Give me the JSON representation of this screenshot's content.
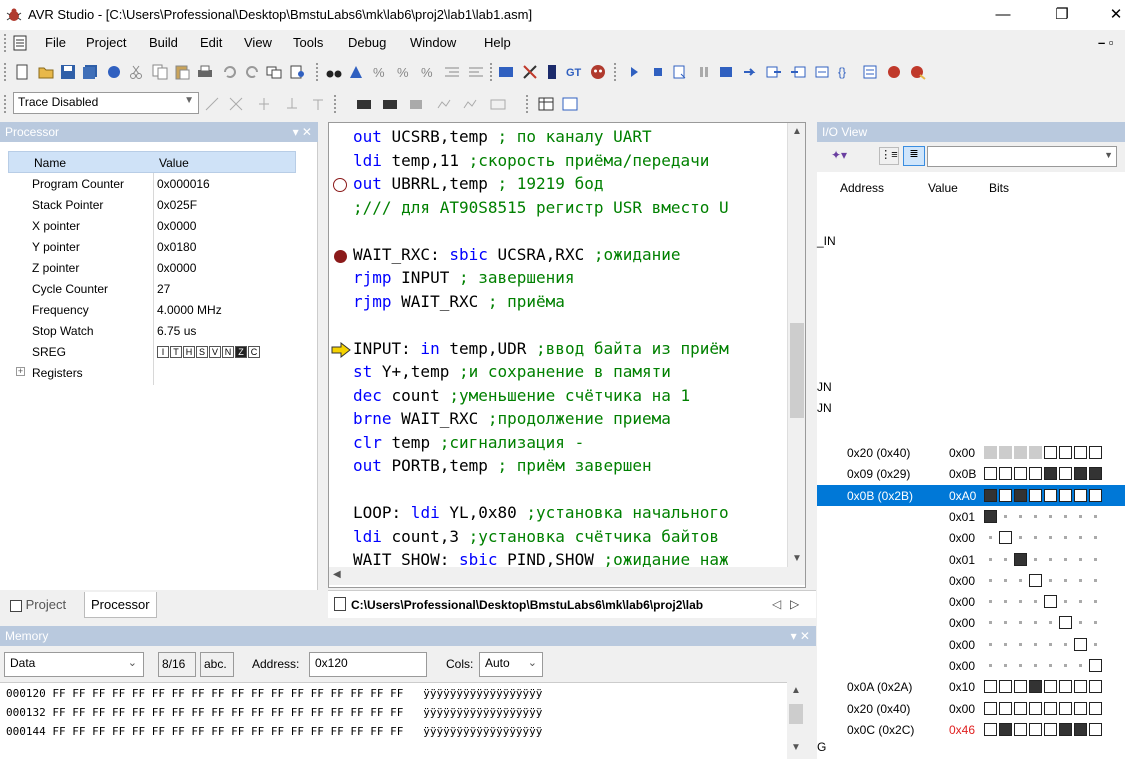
{
  "window": {
    "title": "AVR Studio - [C:\\Users\\Professional\\Desktop\\BmstuLabs6\\mk\\lab6\\proj2\\lab1\\lab1.asm]",
    "minimize": "—",
    "restore": "❐",
    "close": "✕"
  },
  "menu": [
    "File",
    "Project",
    "Build",
    "Edit",
    "View",
    "Tools",
    "Debug",
    "Window",
    "Help"
  ],
  "mdi_controls": "– ▫",
  "trace": {
    "value": "Trace Disabled"
  },
  "processor": {
    "title": "Processor",
    "headers": {
      "name": "Name",
      "value": "Value"
    },
    "rows": [
      {
        "name": "Program Counter",
        "value": "0x000016"
      },
      {
        "name": "Stack Pointer",
        "value": "0x025F"
      },
      {
        "name": "X pointer",
        "value": "0x0000"
      },
      {
        "name": "Y pointer",
        "value": "0x0180"
      },
      {
        "name": "Z pointer",
        "value": "0x0000"
      },
      {
        "name": "Cycle Counter",
        "value": "27"
      },
      {
        "name": "Frequency",
        "value": "4.0000 MHz"
      },
      {
        "name": "Stop Watch",
        "value": "6.75 us"
      }
    ],
    "sreg": {
      "name": "SREG",
      "flags": [
        "I",
        "T",
        "H",
        "S",
        "V",
        "N",
        "Z",
        "C"
      ],
      "set_flags": [
        "Z"
      ]
    },
    "registers": "Registers"
  },
  "tabs": {
    "project": "Project",
    "processor": "Processor"
  },
  "editor": {
    "lines": [
      {
        "marker": "",
        "kw": "out",
        "rest": " UCSRB,temp",
        "comment": " ; по каналу UART"
      },
      {
        "marker": "",
        "kw": "ldi",
        "rest": " temp,11",
        "comment": " ;скорость приёма/передачи"
      },
      {
        "marker": "bp-empty",
        "kw": "out",
        "rest": " UBRRL,temp",
        "comment": " ; 19219 бод"
      },
      {
        "marker": "",
        "kw": "",
        "rest": "",
        "comment": ";/// для AT90S8515 регистр USR вместо U"
      },
      {
        "marker": "",
        "kw": "",
        "rest": "",
        "comment": ""
      },
      {
        "marker": "bp",
        "label": "WAIT_RXC:",
        "kw": " sbic",
        "rest": " UCSRA,RXC",
        "comment": " ;ожидание"
      },
      {
        "marker": "",
        "kw": "rjmp",
        "rest": " INPUT",
        "comment": " ; завершения"
      },
      {
        "marker": "",
        "kw": "rjmp",
        "rest": " WAIT_RXC",
        "comment": " ; приёма"
      },
      {
        "marker": "",
        "kw": "",
        "rest": "",
        "comment": ""
      },
      {
        "marker": "arrow",
        "label": "INPUT:",
        "kw": " in",
        "rest": " temp,UDR",
        "comment": " ;ввод байта из приём"
      },
      {
        "marker": "",
        "kw": "st",
        "rest": " Y+,temp",
        "comment": " ;и сохранение в памяти"
      },
      {
        "marker": "",
        "kw": "dec",
        "rest": " count",
        "comment": " ;уменьшение счётчика на 1"
      },
      {
        "marker": "",
        "kw": "brne",
        "rest": " WAIT_RXC",
        "comment": " ;продолжение приема"
      },
      {
        "marker": "",
        "kw": "clr",
        "rest": " temp",
        "comment": " ;сигнализация -"
      },
      {
        "marker": "",
        "kw": "out",
        "rest": " PORTB,temp",
        "comment": " ; приём завершен"
      },
      {
        "marker": "",
        "kw": "",
        "rest": "",
        "comment": ""
      },
      {
        "marker": "",
        "label": "LOOP:",
        "kw": " ldi",
        "rest": " YL,0x80",
        "comment": " ;установка начального"
      },
      {
        "marker": "",
        "kw": "ldi",
        "rest": " count,3",
        "comment": " ;установка счётчика байтов"
      },
      {
        "marker": "",
        "label": "WAIT_SHOW:",
        "kw": " sbic",
        "rest": " PIND,SHOW",
        "comment": " ;ожидание наж"
      }
    ],
    "file_tab": "C:\\Users\\Professional\\Desktop\\BmstuLabs6\\mk\\lab6\\proj2\\lab"
  },
  "io": {
    "title": "I/O View",
    "headers": {
      "address": "Address",
      "value": "Value",
      "bits": "Bits"
    },
    "side_labels": [
      "_IN",
      "JN",
      "JN",
      "G"
    ],
    "rows": [
      {
        "address": "0x20 (0x40)",
        "value": "0x00",
        "bits": "gggg0000"
      },
      {
        "address": "0x09 (0x29)",
        "value": "0x0B",
        "bits": "00001011"
      },
      {
        "address": "0x0B (0x2B)",
        "value": "0xA0",
        "bits": "10100000",
        "selected": true
      },
      {
        "address": "",
        "value": "0x01",
        "bits": "1......."
      },
      {
        "address": "",
        "value": "0x00",
        "bits": ".0......"
      },
      {
        "address": "",
        "value": "0x01",
        "bits": "..1....."
      },
      {
        "address": "",
        "value": "0x00",
        "bits": "...0...."
      },
      {
        "address": "",
        "value": "0x00",
        "bits": "....0..."
      },
      {
        "address": "",
        "value": "0x00",
        "bits": ".....0.."
      },
      {
        "address": "",
        "value": "0x00",
        "bits": "......0."
      },
      {
        "address": "",
        "value": "0x00",
        "bits": ".......0"
      },
      {
        "address": "0x0A (0x2A)",
        "value": "0x10",
        "bits": "00010000"
      },
      {
        "address": "0x20 (0x40)",
        "value": "0x00",
        "bits": "00000000"
      },
      {
        "address": "0x0C (0x2C)",
        "value": "0x46",
        "bits": "01000110",
        "red": true
      }
    ]
  },
  "memory": {
    "title": "Memory",
    "type": "Data",
    "width": "8/16",
    "abc": "abc.",
    "address_label": "Address:",
    "address": "0x120",
    "cols_label": "Cols:",
    "cols": "Auto",
    "lines": [
      "000120 FF FF FF FF FF FF FF FF FF FF FF FF FF FF FF FF FF FF   ÿÿÿÿÿÿÿÿÿÿÿÿÿÿÿÿÿÿ",
      "000132 FF FF FF FF FF FF FF FF FF FF FF FF FF FF FF FF FF FF   ÿÿÿÿÿÿÿÿÿÿÿÿÿÿÿÿÿÿ",
      "000144 FF FF FF FF FF FF FF FF FF FF FF FF FF FF FF FF FF FF   ÿÿÿÿÿÿÿÿÿÿÿÿÿÿÿÿÿÿ"
    ]
  },
  "colors": {
    "accent": "#0078d7",
    "pane_title": "#b9c9de",
    "keyword": "#0000ff",
    "comment": "#008000"
  }
}
